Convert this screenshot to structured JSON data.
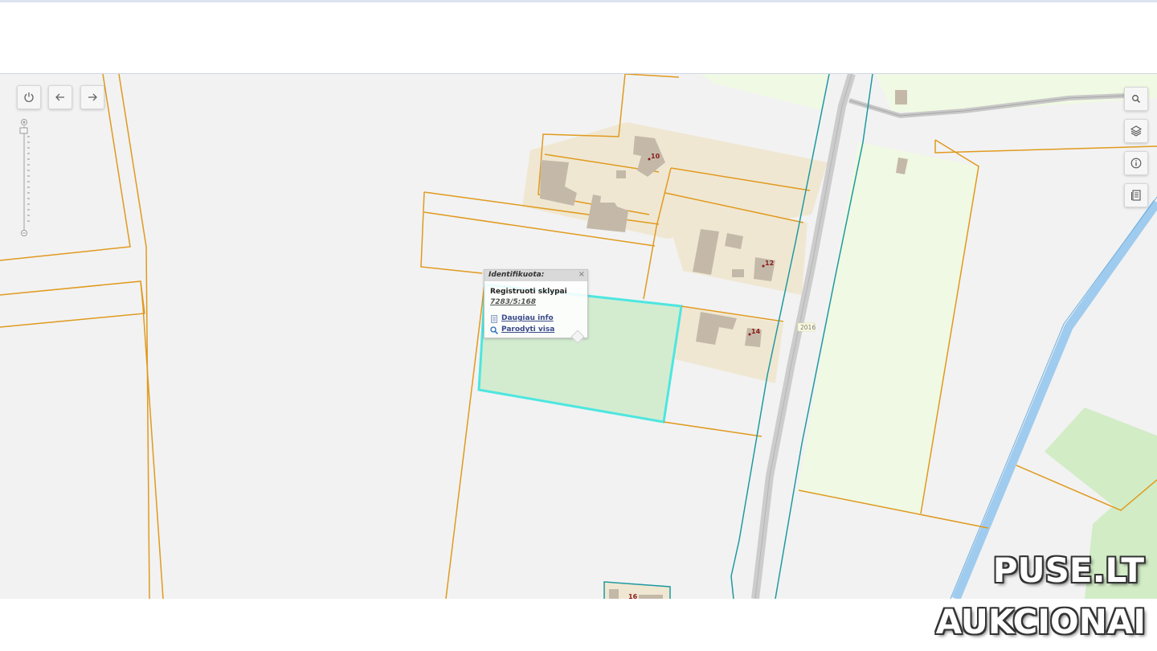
{
  "map": {
    "controls": {
      "power_icon": "power-icon",
      "back_icon": "arrow-left-icon",
      "forward_icon": "arrow-right-icon",
      "search_icon": "search-icon",
      "layers_icon": "layers-icon",
      "info_icon": "info-icon",
      "legend_icon": "document-list-icon"
    },
    "house_numbers": [
      "10",
      "12",
      "14",
      "16"
    ],
    "road_label": "2016",
    "popup": {
      "title": "Identifikuota:",
      "close": "×",
      "layer": "Registruoti sklypai",
      "parcel_id": "7283/5:168",
      "more_info": "Daugiau info",
      "show_all": "Parodyti visa"
    },
    "colors": {
      "parcel_border": "#e09a1e",
      "road_border": "#1e9aa0",
      "selected_parcel_fill": "#d3ecd0",
      "selected_parcel_border": "#4de6e0",
      "residential_area": "#f0e7d2",
      "building": "#c4b9a8",
      "field": "#f0f9e3",
      "meadow": "#d2ecc6",
      "river": "#9fcbee",
      "road": "#c8c8c8"
    }
  },
  "watermark": {
    "line1": "PUSE.LT",
    "line2": "AUKCIONAI"
  }
}
